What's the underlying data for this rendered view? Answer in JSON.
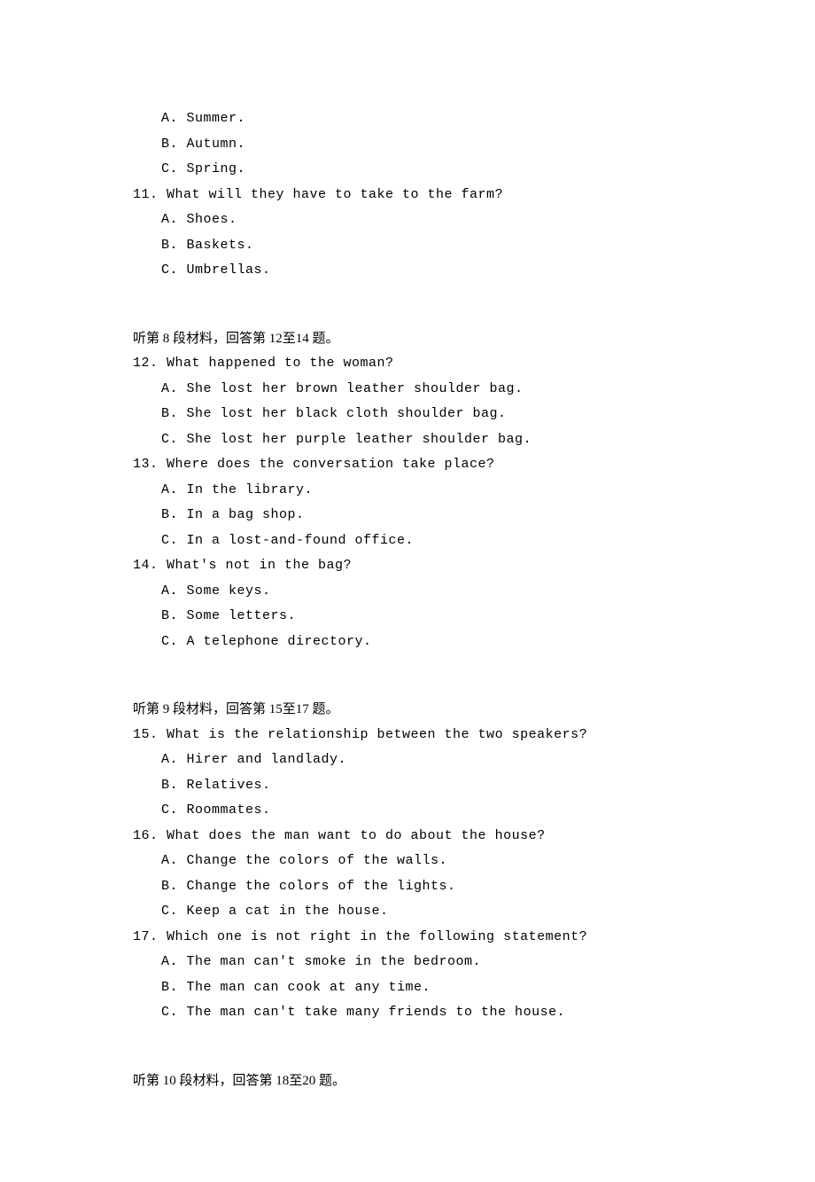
{
  "topOptions": [
    "A. Summer.",
    "B. Autumn.",
    "C. Spring."
  ],
  "q11": {
    "text": "11. What will they have to take to the farm?",
    "options": [
      "A. Shoes.",
      "B. Baskets.",
      "C. Umbrellas."
    ]
  },
  "section8": "听第 8 段材料，回答第 12至14 题。",
  "q12": {
    "text": "12. What happened to the woman?",
    "options": [
      "A. She lost her brown leather shoulder bag.",
      "B. She lost her black cloth shoulder bag.",
      "C. She lost her purple leather shoulder bag."
    ]
  },
  "q13": {
    "text": "13. Where does the conversation take place?",
    "options": [
      "A. In the library.",
      "B. In a bag shop.",
      "C. In a lost-and-found office."
    ]
  },
  "q14": {
    "text": "14. What's not in the bag?",
    "options": [
      "A. Some keys.",
      "B. Some letters.",
      "C. A telephone directory."
    ]
  },
  "section9": "听第 9 段材料，回答第 15至17 题。",
  "q15": {
    "text": "15.  What is the relationship between the two speakers?",
    "options": [
      "A. Hirer and landlady.",
      "B. Relatives.",
      "C. Roommates."
    ]
  },
  "q16": {
    "text": "16. What does the man want to do about the house?",
    "options": [
      "A. Change the colors of the walls.",
      "B. Change the colors of the lights.",
      "C. Keep a cat in the house."
    ]
  },
  "q17": {
    "text": "17. Which one is not right in the following statement?",
    "options": [
      "A. The man can't smoke in the bedroom.",
      "B. The man can cook at any time.",
      "C. The man can't take many friends to the house."
    ]
  },
  "section10": "听第 10 段材料，回答第 18至20 题。"
}
